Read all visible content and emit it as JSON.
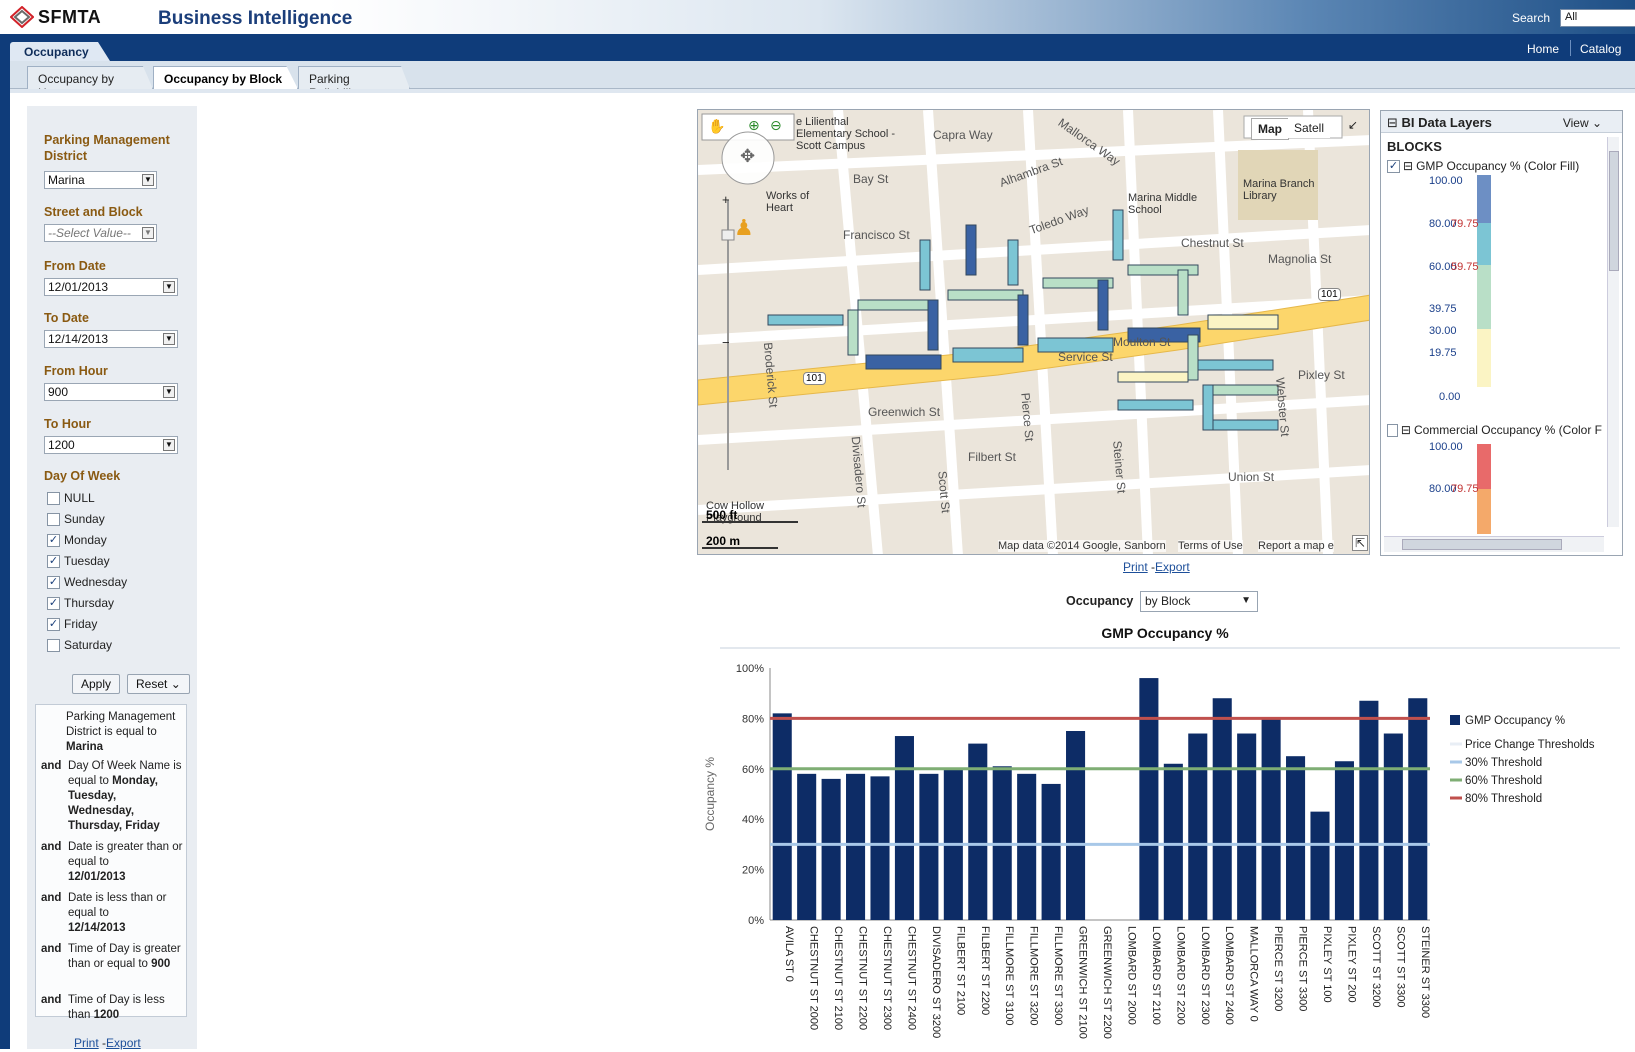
{
  "header": {
    "logo_text": "SFMTA",
    "app_title": "Business Intelligence",
    "search_label": "Search",
    "search_scope": "All"
  },
  "dashboard": {
    "name": "Occupancy",
    "home_link": "Home",
    "catalog_link": "Catalog"
  },
  "tabs": [
    {
      "label": "Occupancy by Hour",
      "active": false
    },
    {
      "label": "Occupancy by Block",
      "active": true
    },
    {
      "label": "Parking Reliability",
      "active": false
    }
  ],
  "prompts": {
    "district_label": "Parking Management District",
    "district_value": "Marina",
    "street_label": "Street and Block",
    "street_placeholder": "--Select Value--",
    "from_date_label": "From Date",
    "from_date_value": "12/01/2013",
    "to_date_label": "To Date",
    "to_date_value": "12/14/2013",
    "from_hour_label": "From Hour",
    "from_hour_value": "900",
    "to_hour_label": "To Hour",
    "to_hour_value": "1200",
    "dow_label": "Day Of Week",
    "days": [
      {
        "label": "NULL",
        "checked": false
      },
      {
        "label": "Sunday",
        "checked": false
      },
      {
        "label": "Monday",
        "checked": true
      },
      {
        "label": "Tuesday",
        "checked": true
      },
      {
        "label": "Wednesday",
        "checked": true
      },
      {
        "label": "Thursday",
        "checked": true
      },
      {
        "label": "Friday",
        "checked": true
      },
      {
        "label": "Saturday",
        "checked": false
      }
    ],
    "apply_label": "Apply",
    "reset_label": "Reset"
  },
  "filters": {
    "f1_pre": "Parking Management District is equal to",
    "f1_val": "Marina",
    "and_label": "and",
    "f2_pre": "Day Of Week Name is equal to",
    "f2_val": "Monday, Tuesday, Wednesday, Thursday, Friday",
    "f3_pre": "Date is greater than or equal to",
    "f3_val": "12/01/2013",
    "f4_pre": "Date is less than or equal to",
    "f4_val": "12/14/2013",
    "f5_pre": "Time of Day is greater than or equal to",
    "f5_val": "900",
    "f6_pre": "Time of Day is less than",
    "f6_val": "1200",
    "print": "Print",
    "export": "Export"
  },
  "map": {
    "map_btn": "Map",
    "satellite_btn": "Satell",
    "scale_ft": "500 ft",
    "scale_m": "200 m",
    "attribution": "Map data ©2014 Google, Sanborn",
    "terms": "Terms of Use",
    "report": "Report a map e",
    "street_labels": [
      "Capra Way",
      "Mallorca Way",
      "Bay St",
      "Alhambra St",
      "Francisco St",
      "Toledo Way",
      "Chestnut St",
      "Magnolia St",
      "Moulton St",
      "Service St",
      "Pixley St",
      "Greenwich St",
      "Filbert St",
      "Union St",
      "Broderick St",
      "Divisadero St",
      "Scott St",
      "Pierce St",
      "Steiner St",
      "Webster St"
    ],
    "places": [
      "Marina Middle School",
      "Marina Branch Library",
      "Works of Heart",
      "e Lilienthal Elementary School - Scott Campus",
      "Cow Hollow Playground"
    ],
    "highway_shield": "101",
    "print": "Print",
    "export": "Export"
  },
  "layers": {
    "title": "BI Data Layers",
    "view": "View",
    "group": "BLOCKS",
    "layer1": "GMP Occupancy % (Color Fill)",
    "layer1_checked": true,
    "layer1_ticks": [
      "100.00",
      "80.00",
      "79.75",
      "60.00",
      "59.75",
      "39.75",
      "30.00",
      "19.75",
      "0.00"
    ],
    "layer2": "Commercial Occupancy % (Color F",
    "layer2_checked": false,
    "layer2_ticks": [
      "100.00",
      "80.00",
      "79.75"
    ]
  },
  "occupancy_selector": {
    "label": "Occupancy",
    "value": "by Block"
  },
  "chart_data": {
    "type": "bar",
    "title": "GMP Occupancy %",
    "ylabel": "Occupancy %",
    "xlabel": "",
    "ylim": [
      0,
      100
    ],
    "yticks": [
      "0%",
      "20%",
      "40%",
      "60%",
      "80%",
      "100%"
    ],
    "categories": [
      "AVILA ST 0",
      "CHESTNUT ST 2000",
      "CHESTNUT ST 2100",
      "CHESTNUT ST 2200",
      "CHESTNUT ST 2300",
      "CHESTNUT ST 2400",
      "DIVISADERO ST 3200",
      "FILBERT ST 2100",
      "FILBERT ST 2200",
      "FILLMORE ST 3100",
      "FILLMORE ST 3200",
      "FILLMORE ST 3300",
      "GREENWICH ST 2100",
      "GREENWICH ST 2200",
      "LOMBARD ST 2000",
      "LOMBARD ST 2100",
      "LOMBARD ST 2200",
      "LOMBARD ST 2300",
      "LOMBARD ST 2400",
      "MALLORCA WAY 0",
      "PIERCE ST 3200",
      "PIERCE ST 3300",
      "PIXLEY ST 100",
      "PIXLEY ST 200",
      "SCOTT ST 3200",
      "SCOTT ST 3300",
      "STEINER ST 3300"
    ],
    "series": [
      {
        "name": "GMP Occupancy %",
        "color": "#0d2c66",
        "values": [
          82,
          58,
          56,
          58,
          57,
          73,
          58,
          60,
          70,
          61,
          58,
          54,
          75,
          0,
          0,
          96,
          62,
          74,
          88,
          74,
          80,
          65,
          43,
          63,
          87,
          74,
          88
        ]
      }
    ],
    "thresholds": [
      {
        "name": "30% Threshold",
        "value": 30,
        "color": "#a8c8e8"
      },
      {
        "name": "60% Threshold",
        "value": 60,
        "color": "#7fae74"
      },
      {
        "name": "80% Threshold",
        "value": 80,
        "color": "#c0504d"
      }
    ],
    "legend": [
      "GMP Occupancy %",
      "Price Change Thresholds",
      "30% Threshold",
      "60% Threshold",
      "80% Threshold"
    ],
    "legend_position": "right"
  }
}
